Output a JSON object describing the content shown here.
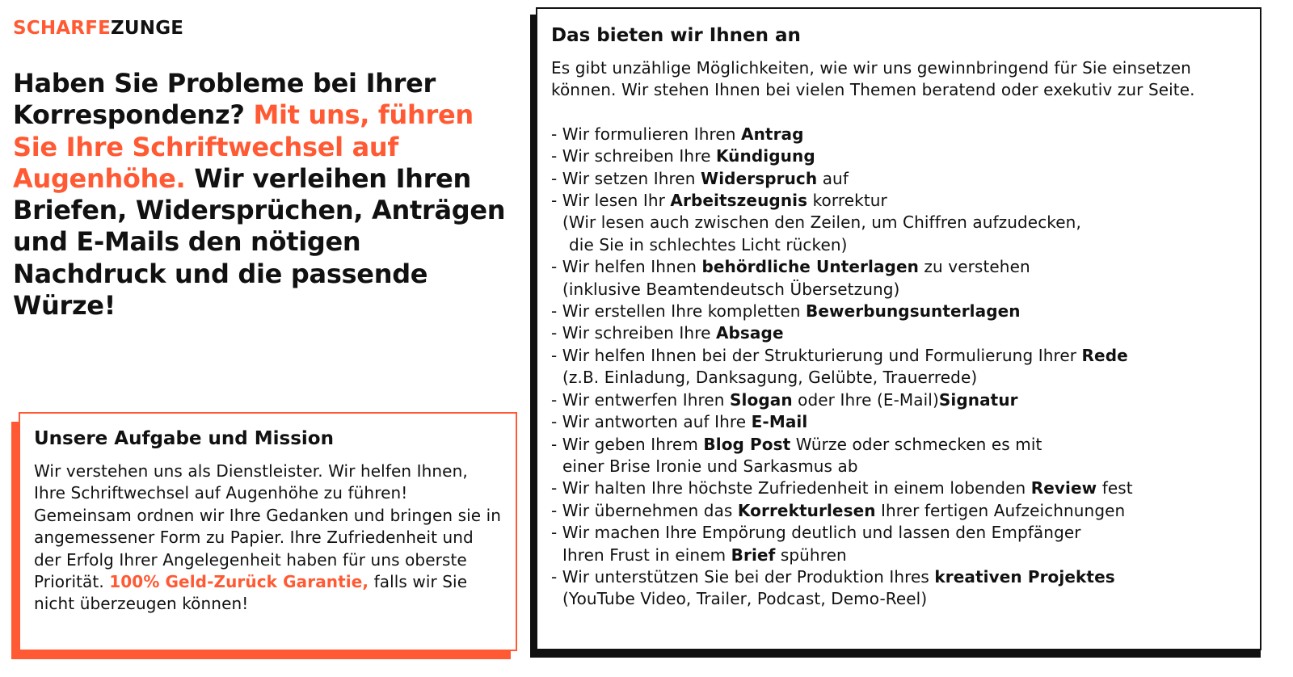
{
  "brand": {
    "part1": "SCHARFE",
    "part2": "ZUNGE",
    "accent_color": "#ff5a33"
  },
  "headline": {
    "part1": "Haben Sie Probleme bei Ihrer Korrespondenz? ",
    "accent": "Mit uns, führen Sie Ihre Schriftwechsel auf Augenhöhe.",
    "part2": " Wir verleihen Ihren Briefen, Widersprüchen, Anträgen und E-Mails den nötigen Nachdruck und die passende Würze!"
  },
  "mission": {
    "title": "Unsere Aufgabe und Mission",
    "text": "Wir verstehen uns als Dienstleister. Wir helfen Ihnen, Ihre Schriftwechsel auf Augenhöhe zu führen! Gemeinsam ordnen wir Ihre Gedanken und bringen sie in angemessener Form zu Papier. Ihre Zufriedenheit und der Erfolg Ihrer Angelegenheit haben für uns oberste Priorität. ",
    "guarantee": "100% Geld-Zurück Garantie,",
    "closing": " falls wir Sie nicht überzeugen können!"
  },
  "services": {
    "title": "Das bieten wir Ihnen an",
    "intro": "Es gibt unzählige Möglichkeiten, wie wir uns gewinnbringend für Sie einsetzen können. Wir stehen Ihnen bei vielen Themen beratend oder exekutiv zur Seite.",
    "items": [
      {
        "pre": "- Wir formulieren Ihren ",
        "bold": "Antrag",
        "post": ""
      },
      {
        "pre": "- Wir schreiben Ihre ",
        "bold": "Kündigung",
        "post": ""
      },
      {
        "pre": "- Wir setzen Ihren ",
        "bold": "Widerspruch",
        "post": " auf"
      },
      {
        "pre": "- Wir lesen Ihr ",
        "bold": "Arbeitszeugnis",
        "post": " korrektur",
        "sub": "(Wir lesen auch zwischen den Zeilen, um Chiffren aufzudecken,",
        "sub2": "die Sie in schlechtes Licht rücken)"
      },
      {
        "pre": "- Wir helfen Ihnen ",
        "bold": "behördliche Unterlagen",
        "post": " zu verstehen",
        "sub": "(inklusive Beamtendeutsch Übersetzung)"
      },
      {
        "pre": "- Wir erstellen Ihre kompletten ",
        "bold": "Bewerbungsunterlagen",
        "post": ""
      },
      {
        "pre": "- Wir schreiben Ihre ",
        "bold": "Absage",
        "post": ""
      },
      {
        "pre": "- Wir helfen Ihnen bei der Strukturierung und Formulierung Ihrer ",
        "bold": "Rede",
        "post": "",
        "sub": "(z.B. Einladung, Danksagung, Gelübte, Trauerrede)"
      },
      {
        "pre": "- Wir entwerfen Ihren ",
        "bold": "Slogan",
        "post": " oder Ihre (E-Mail)",
        "bold2": "Signatur"
      },
      {
        "pre": "- Wir antworten auf Ihre ",
        "bold": "E-Mail",
        "post": ""
      },
      {
        "pre": "- Wir geben Ihrem ",
        "bold": "Blog Post",
        "post": " Würze oder schmecken es mit",
        "sub": "einer Brise Ironie und Sarkasmus ab"
      },
      {
        "pre": "- Wir halten Ihre höchste Zufriedenheit in einem lobenden ",
        "bold": "Review",
        "post": " fest"
      },
      {
        "pre": "- Wir übernehmen das ",
        "bold": "Korrekturlesen",
        "post": " Ihrer fertigen Aufzeichnungen"
      },
      {
        "pre": "- Wir machen Ihre Empörung deutlich und lassen den Empfänger",
        "bold": "",
        "post": "",
        "sub_pre": "Ihren Frust in einem ",
        "sub_bold": "Brief",
        "sub_post": " spühren"
      },
      {
        "pre": "- Wir unterstützen Sie bei der Produktion Ihres ",
        "bold": "kreativen Projektes",
        "post": "",
        "sub": "(YouTube Video, Trailer, Podcast, Demo-Reel)"
      }
    ]
  }
}
